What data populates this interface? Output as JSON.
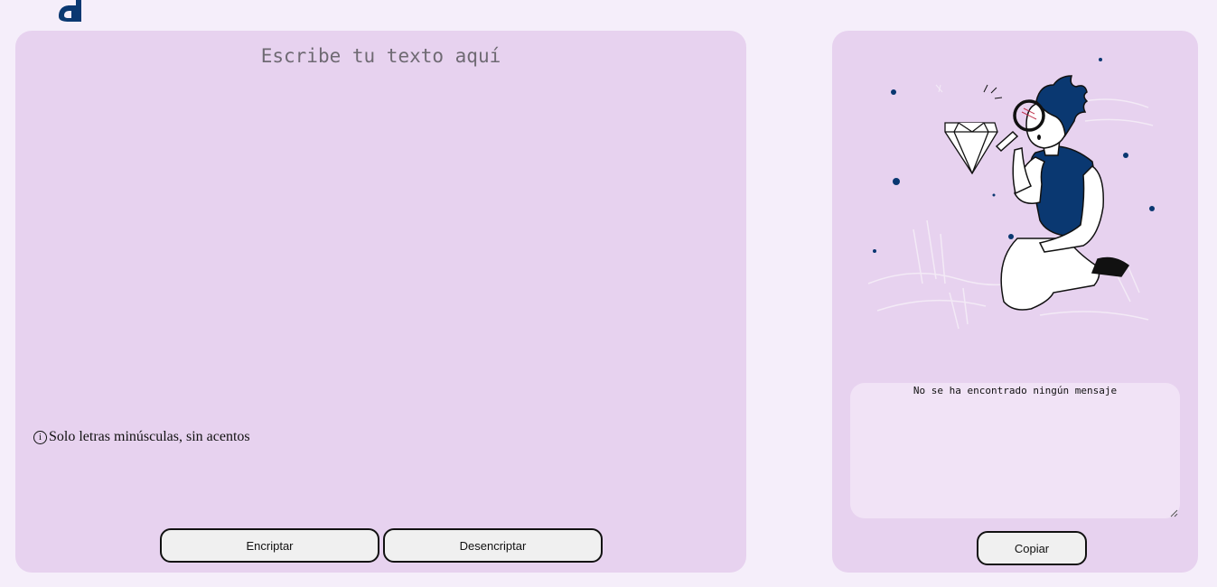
{
  "input": {
    "placeholder": "Escribe tu texto aquí"
  },
  "hint": {
    "icon": "info-icon",
    "icon_glyph": "i",
    "text": "Solo letras minúsculas, sin acentos"
  },
  "buttons": {
    "encrypt_label": "Encriptar",
    "decrypt_label": "Desencriptar",
    "copy_label": "Copiar"
  },
  "output": {
    "message": "No se ha encontrado ningún mensaje"
  },
  "illustration": {
    "icon": "person-with-magnifier-and-diamond-illustration"
  },
  "colors": {
    "background": "#f5eefa",
    "panel": "#e7d2ef",
    "output_bg": "#f1e3f6",
    "accent": "#0a3871"
  }
}
